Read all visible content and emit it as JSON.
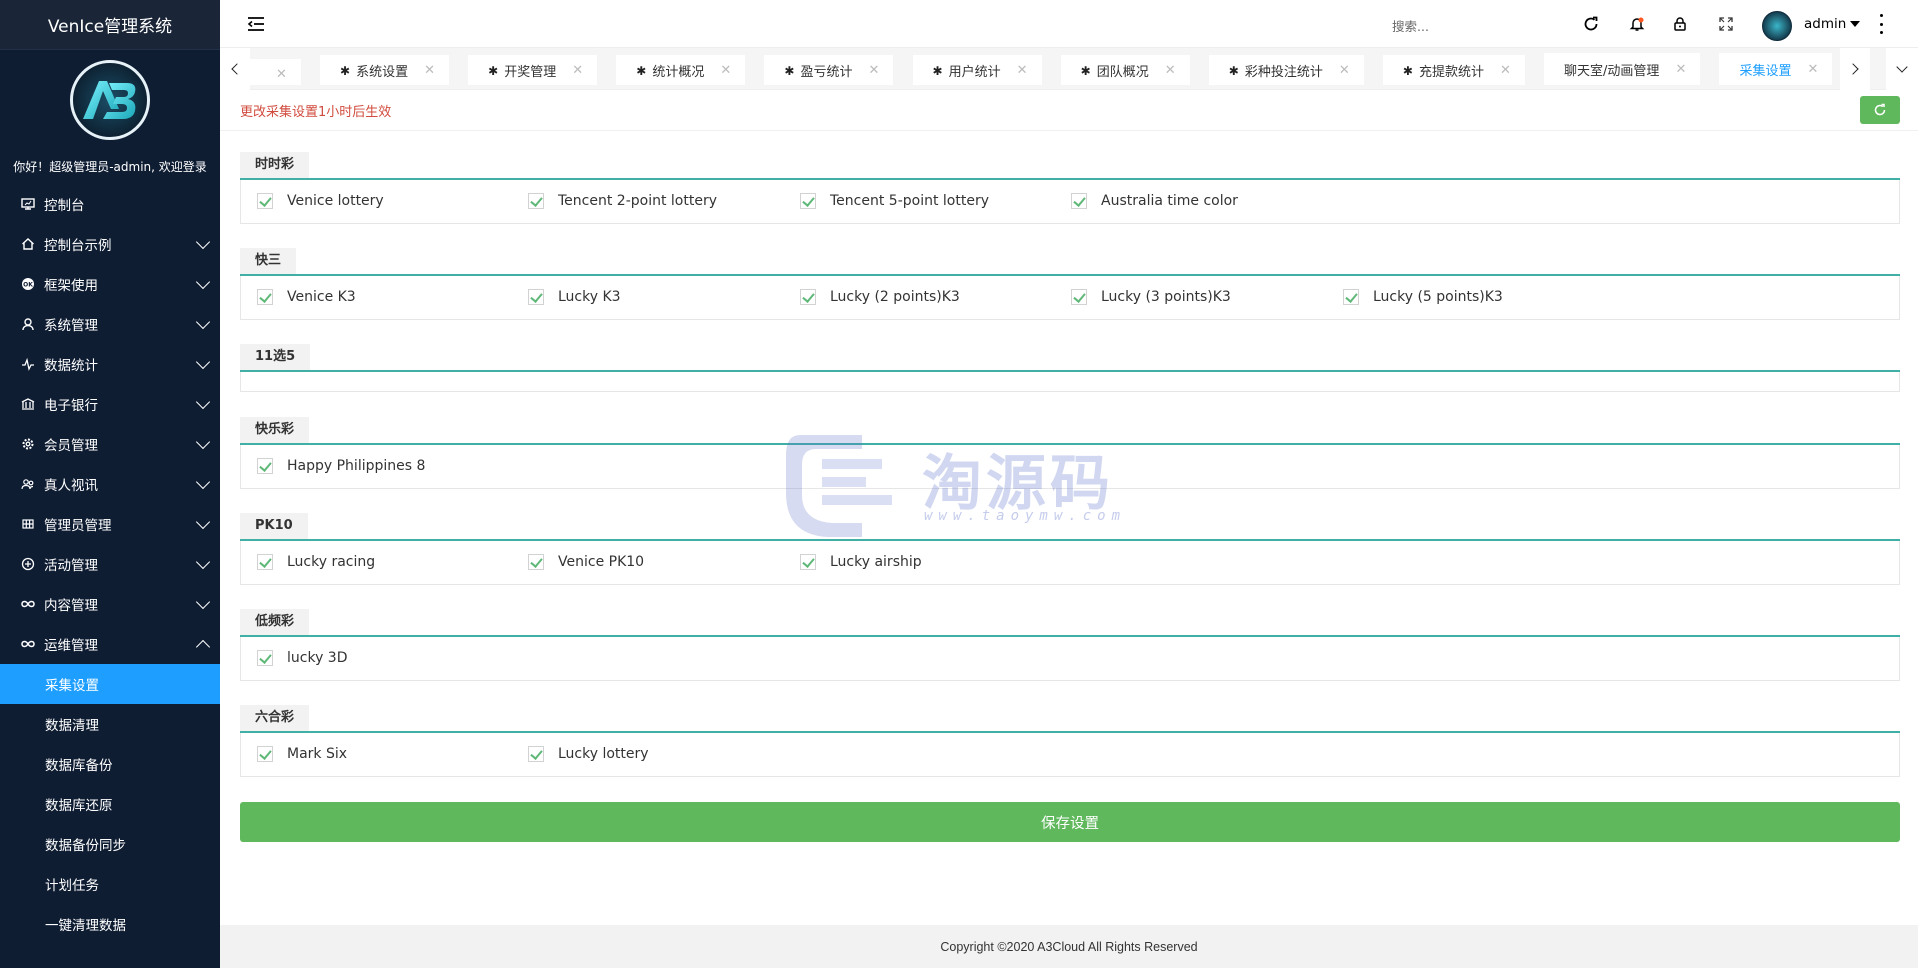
{
  "app": {
    "title": "VenIce管理系统",
    "welcome": "你好！超级管理员-admin, 欢迎登录"
  },
  "sidebar": {
    "items": [
      {
        "label": "控制台",
        "icon": "monitor-icon",
        "expandable": false
      },
      {
        "label": "控制台示例",
        "icon": "home-icon",
        "expandable": true
      },
      {
        "label": "框架使用",
        "icon": "ok-icon",
        "expandable": true
      },
      {
        "label": "系统管理",
        "icon": "user-icon",
        "expandable": true
      },
      {
        "label": "数据统计",
        "icon": "pulse-icon",
        "expandable": true
      },
      {
        "label": "电子银行",
        "icon": "bank-icon",
        "expandable": true
      },
      {
        "label": "会员管理",
        "icon": "gear-icon",
        "expandable": true
      },
      {
        "label": "真人视讯",
        "icon": "people-icon",
        "expandable": true
      },
      {
        "label": "管理员管理",
        "icon": "grid-icon",
        "expandable": true
      },
      {
        "label": "活动管理",
        "icon": "plus-circle-icon",
        "expandable": true
      },
      {
        "label": "内容管理",
        "icon": "infinity-icon",
        "expandable": true
      },
      {
        "label": "运维管理",
        "icon": "infinity-icon",
        "expandable": true,
        "expanded": true
      }
    ],
    "sub_items": [
      {
        "label": "采集设置",
        "active": true
      },
      {
        "label": "数据清理"
      },
      {
        "label": "数据库备份"
      },
      {
        "label": "数据库还原"
      },
      {
        "label": "数据备份同步"
      },
      {
        "label": "计划任务"
      },
      {
        "label": "一键清理数据"
      }
    ]
  },
  "header": {
    "search_placeholder": "搜索...",
    "user": "admin"
  },
  "tabs": [
    {
      "label": "",
      "icon": false
    },
    {
      "label": "系统设置",
      "icon": true
    },
    {
      "label": "开奖管理",
      "icon": true
    },
    {
      "label": "统计概况",
      "icon": true
    },
    {
      "label": "盈亏统计",
      "icon": true
    },
    {
      "label": "用户统计",
      "icon": true
    },
    {
      "label": "团队概况",
      "icon": true
    },
    {
      "label": "彩种投注统计",
      "icon": true
    },
    {
      "label": "充提款统计",
      "icon": true
    },
    {
      "label": "聊天室/动画管理",
      "icon": false
    },
    {
      "label": "采集设置",
      "icon": false,
      "active": true
    }
  ],
  "notice": "更改采集设置1小时后生效",
  "groups": [
    {
      "title": "时时彩",
      "options": [
        "Venice lottery",
        "Tencent 2-point lottery",
        "Tencent 5-point lottery",
        "Australia time color"
      ]
    },
    {
      "title": "快三",
      "options": [
        "Venice K3",
        "Lucky K3",
        "Lucky (2 points)K3",
        "Lucky (3 points)K3",
        "Lucky (5 points)K3"
      ]
    },
    {
      "title": "11选5",
      "options": []
    },
    {
      "title": "快乐彩",
      "options": [
        "Happy Philippines 8"
      ]
    },
    {
      "title": "PK10",
      "options": [
        "Lucky racing",
        "Venice PK10",
        "Lucky airship"
      ]
    },
    {
      "title": "低频彩",
      "options": [
        "lucky 3D"
      ]
    },
    {
      "title": "六合彩",
      "options": [
        "Mark Six",
        "Lucky lottery"
      ]
    }
  ],
  "save_label": "保存设置",
  "footer": "Copyright ©2020 A3Cloud All Rights Reserved",
  "watermark": {
    "text": "淘源码",
    "url": "www.taoymw.com"
  },
  "colors": {
    "sidebar_bg": "#0f1d33",
    "active": "#1e9fff",
    "success": "#5fb85c",
    "notice": "#d14b3e",
    "accent_line": "#009688"
  }
}
